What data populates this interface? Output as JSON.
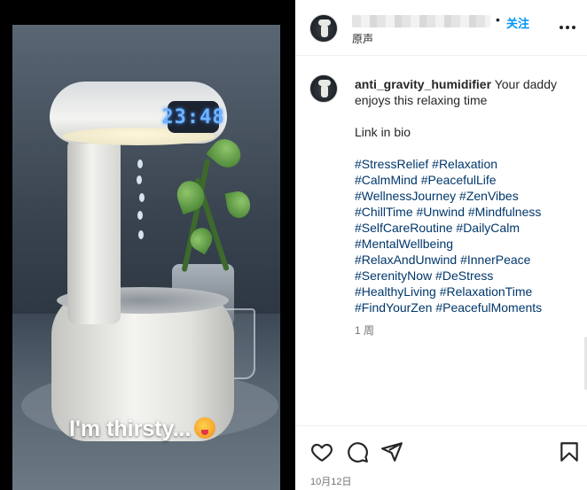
{
  "media": {
    "clock_text": "23:48",
    "caption_text": "I'm thirsty..."
  },
  "header": {
    "dot": "•",
    "follow_label": "关注",
    "audio_label": "原声"
  },
  "post": {
    "username": "anti_gravity_humidifier",
    "text": "Your daddy enjoys this relaxing time",
    "link_text": "Link in bio",
    "hashtags": [
      "#StressRelief",
      "#Relaxation",
      "#CalmMind",
      "#PeacefulLife",
      "#WellnessJourney",
      "#ZenVibes",
      "#ChillTime",
      "#Unwind",
      "#Mindfulness",
      "#SelfCareRoutine",
      "#DailyCalm",
      "#MentalWellbeing",
      "#RelaxAndUnwind",
      "#InnerPeace",
      "#SerenityNow",
      "#DeStress",
      "#HealthyLiving",
      "#RelaxationTime",
      "#FindYourZen",
      "#PeacefulMoments"
    ],
    "time_ago": "1 周"
  },
  "actions": {
    "icons": [
      "heart-icon",
      "comment-icon",
      "share-icon",
      "bookmark-icon"
    ]
  },
  "footer": {
    "date": "10月12日"
  }
}
